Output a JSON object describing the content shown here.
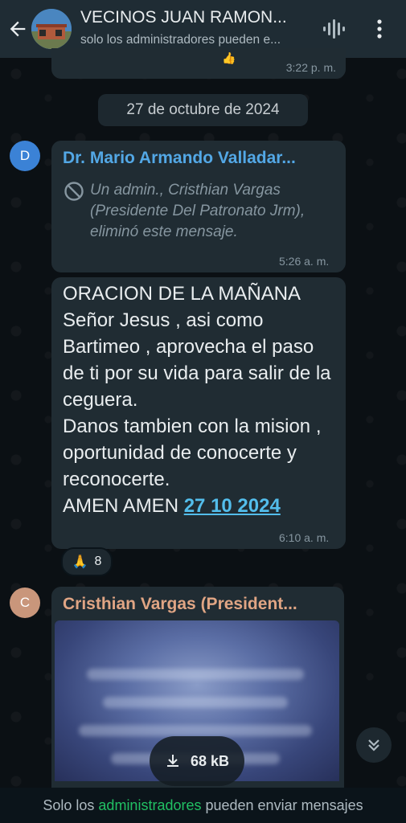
{
  "header": {
    "title": "VECINOS JUAN RAMON...",
    "subtitle": "solo los administradores pueden e..."
  },
  "top_message": {
    "time": "3:22 p. m.",
    "emoji": "👍"
  },
  "date_separator": "27 de octubre de 2024",
  "deleted_message": {
    "avatar_letter": "D",
    "sender": "Dr. Mario Armando Valladar...",
    "text": "Un admin., Cristhian Vargas (Presidente Del Patronato Jrm), eliminó este mensaje.",
    "time": "5:26 a. m."
  },
  "prayer_message": {
    "text": "ORACION DE LA MAÑANA\nSeñor Jesus , asi como Bartimeo , aprovecha el paso de ti por su vida para salir de la ceguera.\nDanos tambien  con la mision ,   oportunidad de conocerte y reconocerte.\nAMEN AMEN ",
    "link": "27 10 2024",
    "time": "6:10 a. m.",
    "reaction_emoji": "🙏",
    "reaction_count": "8"
  },
  "image_message": {
    "avatar_letter": "C",
    "sender": "Cristhian Vargas (President...",
    "download_size": "68 kB"
  },
  "footer": {
    "prefix": "Solo los ",
    "link": "administradores",
    "suffix": " pueden enviar mensajes"
  },
  "colors": {
    "sender1": "#53a8e6",
    "sender2": "#e0a584",
    "avatar_d": "#3b82d6",
    "avatar_c": "#c9967b",
    "link": "#53bdeb",
    "footer_link": "#21c063"
  }
}
